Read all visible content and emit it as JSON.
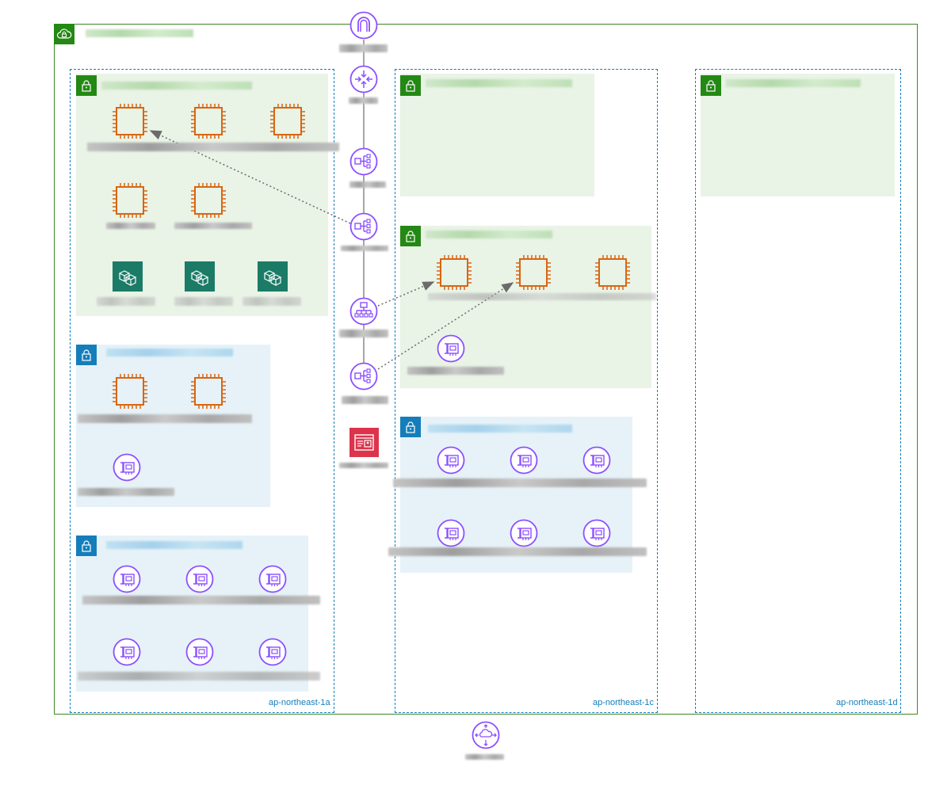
{
  "availability_zones": [
    {
      "label": "ap-northeast-1a"
    },
    {
      "label": "ap-northeast-1c"
    },
    {
      "label": "ap-northeast-1d"
    }
  ],
  "colors": {
    "vpc_border": "#3F8624",
    "az_border": "#147EBA",
    "public_subnet_fill": "#E9F3E6",
    "private_subnet_fill": "#E6F2F8",
    "ec2_orange": "#D86613",
    "network_purple": "#8C4FFF",
    "ecr_teal": "#1B7B67",
    "waf_red": "#DD344C"
  },
  "icons": {
    "vpc": "cloud-lock-icon",
    "subnet": "lock-icon",
    "ec2": "chip-icon",
    "eni": "network-interface-icon",
    "container": "container-cubes-icon",
    "gateway": "internet-gateway-icon",
    "router": "router-icon",
    "load_balancer": "load-balancer-icon",
    "alb": "application-load-balancer-icon",
    "waf": "web-firewall-icon",
    "transit": "transit-gateway-icon"
  }
}
